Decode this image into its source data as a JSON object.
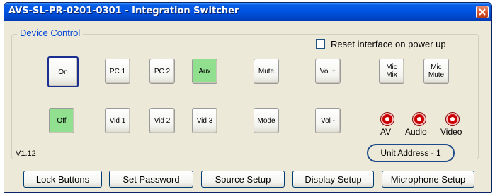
{
  "window": {
    "title": "AVS-SL-PR-0201-0301 - Integration Switcher",
    "close_icon": "close-icon"
  },
  "device_control": {
    "group_label": "Device Control",
    "reset_checkbox": {
      "label": "Reset interface on power up",
      "checked": false
    },
    "buttons": {
      "on": "On",
      "off": "Off",
      "pc1": "PC 1",
      "pc2": "PC 2",
      "aux": "Aux",
      "vid1": "Vid 1",
      "vid2": "Vid 2",
      "vid3": "Vid 3",
      "mute": "Mute",
      "mode": "Mode",
      "vol_up": "Vol +",
      "vol_down": "Vol -",
      "mic_mix": "Mic\nMix",
      "mic_mute": "Mic\nMute"
    },
    "active_buttons": [
      "off",
      "aux"
    ],
    "indicators": [
      {
        "label": "AV",
        "color": "#cc0000"
      },
      {
        "label": "Audio",
        "color": "#cc0000"
      },
      {
        "label": "Video",
        "color": "#cc0000"
      }
    ],
    "version": "V1.12",
    "unit_address": "Unit Address - 1"
  },
  "bottom_bar": {
    "lock_buttons": "Lock Buttons",
    "set_password": "Set Password",
    "source_setup": "Source Setup",
    "display_setup": "Display Setup",
    "microphone_setup": "Microphone Setup"
  },
  "colors": {
    "titlebar": "#0054e3",
    "window_bg": "#ece9d8",
    "active_button": "#90e090",
    "group_label": "#0046d5"
  }
}
